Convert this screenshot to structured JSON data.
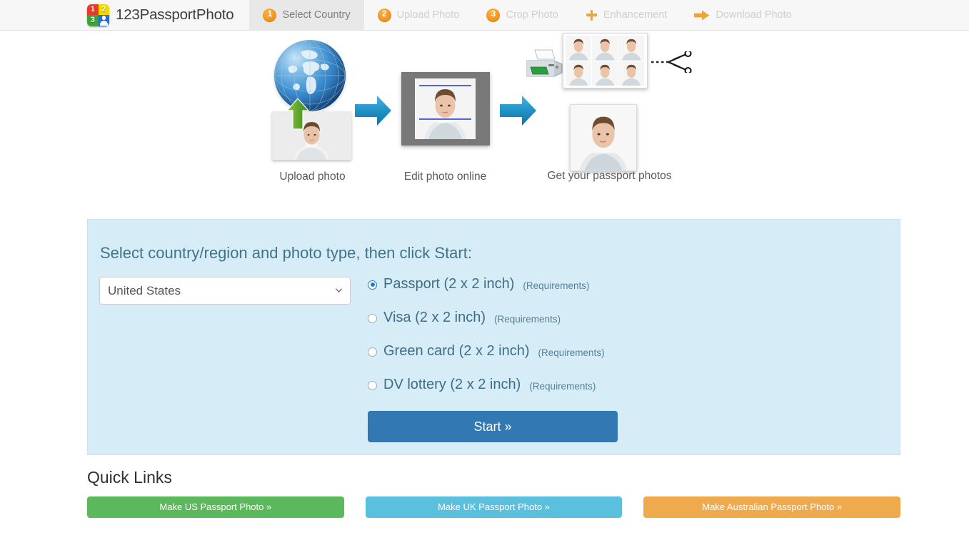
{
  "brand": {
    "name": "123PassportPhoto",
    "logo_cells": [
      "1",
      "2",
      "3",
      "person-icon"
    ]
  },
  "nav": {
    "items": [
      {
        "label": "Select Country",
        "badge": "1",
        "icon": "number-badge-1",
        "active": true
      },
      {
        "label": "Upload Photo",
        "badge": "2",
        "icon": "number-badge-2",
        "active": false
      },
      {
        "label": "Crop Photo",
        "badge": "3",
        "icon": "number-badge-3",
        "active": false
      },
      {
        "label": "Enhancement",
        "badge": "+",
        "icon": "plus-icon",
        "active": false
      },
      {
        "label": "Download Photo",
        "badge": "",
        "icon": "arrow-right-icon",
        "active": false
      }
    ]
  },
  "hero": {
    "captions": [
      "Upload photo",
      "Edit photo online",
      "Get your passport photos"
    ],
    "icons": [
      "globe-icon",
      "green-up-arrow-icon",
      "blue-arrow-icon",
      "printer-icon",
      "scissors-icon"
    ]
  },
  "panel": {
    "heading": "Select country/region and photo type, then click Start:",
    "country_select": {
      "selected": "United States",
      "options": [
        "United States"
      ]
    },
    "photo_types": [
      {
        "label": "Passport (2 x 2 inch)",
        "requirements": "(Requirements)",
        "selected": true
      },
      {
        "label": "Visa (2 x 2 inch)",
        "requirements": "(Requirements)",
        "selected": false
      },
      {
        "label": "Green card (2 x 2 inch)",
        "requirements": "(Requirements)",
        "selected": false
      },
      {
        "label": "DV lottery (2 x 2 inch)",
        "requirements": "(Requirements)",
        "selected": false
      }
    ],
    "start_button": "Start »"
  },
  "quick_links": {
    "title": "Quick Links",
    "buttons": [
      {
        "label": "Make US Passport Photo »",
        "color": "#5cb85c"
      },
      {
        "label": "Make UK Passport Photo »",
        "color": "#5bc0de"
      },
      {
        "label": "Make Australian Passport Photo »",
        "color": "#eeaa4d"
      }
    ]
  },
  "colors": {
    "header_bg": "#f7f7f7",
    "active_tab_bg": "#e8e8e8",
    "step_badge": "#f39019",
    "panel_bg": "#d6ecf6",
    "panel_heading": "#41738c",
    "start_button": "#3279b4",
    "radio_accent": "#1a7fd4"
  }
}
